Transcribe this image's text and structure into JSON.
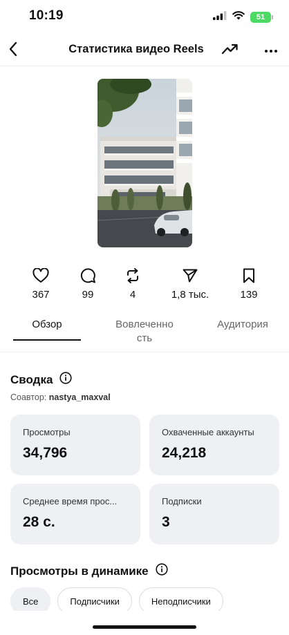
{
  "status_bar": {
    "time": "10:19",
    "battery": "51",
    "icons": [
      "signal-icon",
      "wifi-icon",
      "battery-icon"
    ]
  },
  "nav": {
    "title": "Статистика видео Reels",
    "icons": [
      "back-chevron-icon",
      "trending-icon",
      "more-icon"
    ]
  },
  "video": {
    "thumbnail": "building-photo"
  },
  "stats": [
    {
      "icon": "heart-icon",
      "value": "367"
    },
    {
      "icon": "comment-icon",
      "value": "99"
    },
    {
      "icon": "repost-icon",
      "value": "4"
    },
    {
      "icon": "send-icon",
      "value": "1,8 тыс."
    },
    {
      "icon": "bookmark-icon",
      "value": "139"
    }
  ],
  "tabs": [
    {
      "label": "Обзор",
      "active": true
    },
    {
      "label": "Вовлеченно\nсть",
      "active": false
    },
    {
      "label": "Аудитория",
      "active": false
    }
  ],
  "summary": {
    "title": "Сводка",
    "coauthor_label": "Соавтор:",
    "coauthor_name": "nastya_maxval",
    "cards": [
      {
        "label": "Просмотры",
        "value": "34,796"
      },
      {
        "label": "Охваченные аккаунты",
        "value": "24,218"
      },
      {
        "label": "Среднее время прос...",
        "value": "28 с."
      },
      {
        "label": "Подписки",
        "value": "3"
      }
    ]
  },
  "dynamics": {
    "title": "Просмотры в динамике",
    "filters": [
      {
        "label": "Все",
        "active": true
      },
      {
        "label": "Подписчики",
        "active": false
      },
      {
        "label": "Неподписчики",
        "active": false
      }
    ]
  },
  "colors": {
    "card_bg": "#eef0f4",
    "battery": "#4cd964",
    "text": "#111111"
  }
}
